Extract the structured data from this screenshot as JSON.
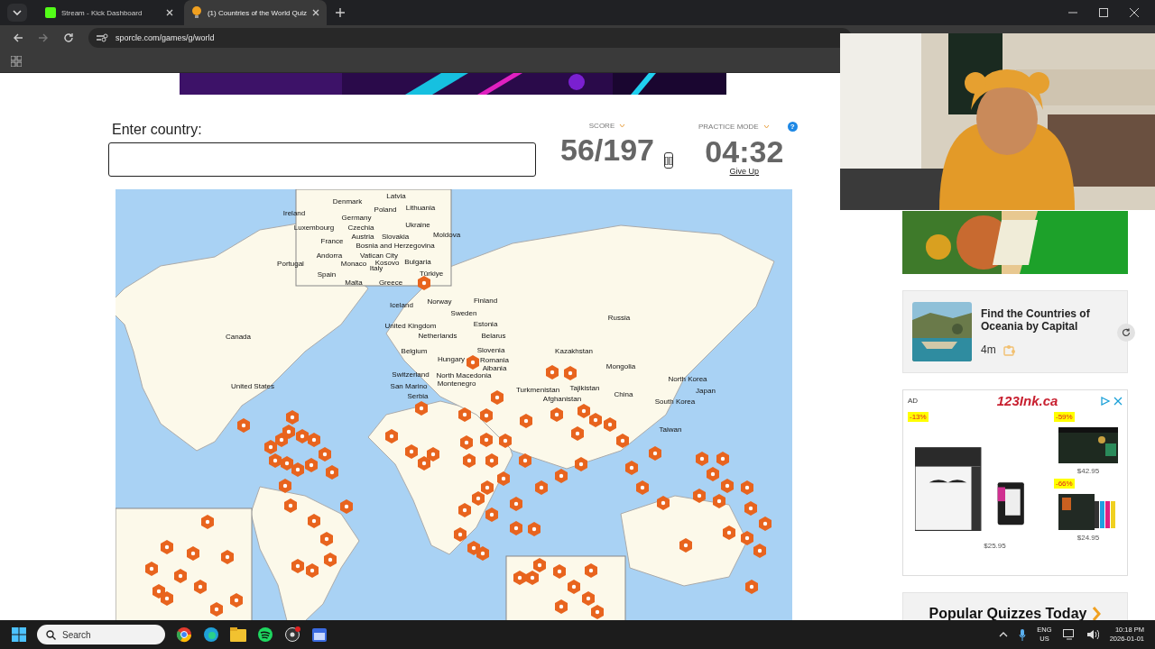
{
  "browser": {
    "tabs": [
      {
        "title": "Stream - Kick Dashboard",
        "kind": "kick",
        "selected": false
      },
      {
        "title": "(1) Countries of the World Quiz",
        "kind": "sporcle",
        "selected": true
      }
    ],
    "url": "sporcle.com/games/g/world"
  },
  "quiz": {
    "input_label": "Enter country:",
    "score_label": "SCORE",
    "score": "56/197",
    "mode_label": "PRACTICE MODE",
    "help": "?",
    "timer": "04:32",
    "give_up": "Give Up"
  },
  "map": {
    "labels": [
      {
        "name": "Denmark"
      },
      {
        "name": "Latvia"
      },
      {
        "name": "Lithuania"
      },
      {
        "name": "Poland"
      },
      {
        "name": "Ireland"
      },
      {
        "name": "Germany"
      },
      {
        "name": "Ukraine"
      },
      {
        "name": "Luxembourg"
      },
      {
        "name": "Czechia"
      },
      {
        "name": "Moldova"
      },
      {
        "name": "Austria"
      },
      {
        "name": "Slovakia"
      },
      {
        "name": "France"
      },
      {
        "name": "Bosnia and Herzegovina"
      },
      {
        "name": "Andorra"
      },
      {
        "name": "Vatican City"
      },
      {
        "name": "Portugal"
      },
      {
        "name": "Monaco"
      },
      {
        "name": "Kosovo"
      },
      {
        "name": "Bulgaria"
      },
      {
        "name": "Italy"
      },
      {
        "name": "Türkiye"
      },
      {
        "name": "Spain"
      },
      {
        "name": "Malta"
      },
      {
        "name": "Greece"
      },
      {
        "name": "Iceland"
      },
      {
        "name": "Norway"
      },
      {
        "name": "Finland"
      },
      {
        "name": "Sweden"
      },
      {
        "name": "Russia"
      },
      {
        "name": "United Kingdom"
      },
      {
        "name": "Estonia"
      },
      {
        "name": "Canada"
      },
      {
        "name": "Netherlands"
      },
      {
        "name": "Belarus"
      },
      {
        "name": "Belgium"
      },
      {
        "name": "Slovenia"
      },
      {
        "name": "Kazakhstan"
      },
      {
        "name": "Hungary"
      },
      {
        "name": "Romania"
      },
      {
        "name": "Albania"
      },
      {
        "name": "Mongolia"
      },
      {
        "name": "Switzerland"
      },
      {
        "name": "North Macedonia"
      },
      {
        "name": "North Korea"
      },
      {
        "name": "United States"
      },
      {
        "name": "San Marino"
      },
      {
        "name": "Montenegro"
      },
      {
        "name": "Turkmenistan"
      },
      {
        "name": "Tajikistan"
      },
      {
        "name": "Japan"
      },
      {
        "name": "Serbia"
      },
      {
        "name": "Afghanistan"
      },
      {
        "name": "China"
      },
      {
        "name": "South Korea"
      },
      {
        "name": "Taiwan"
      }
    ]
  },
  "sidebar": {
    "related": {
      "title": "Find the Countries of Oceania by Capital",
      "time": "4m"
    },
    "ad": {
      "badge": "AD",
      "brand": "123Ink.ca",
      "products": [
        {
          "discount": "-13%",
          "price": "$25.95"
        },
        {
          "discount": "-59%",
          "price": "$42.95"
        },
        {
          "discount": "-66%",
          "price": "$24.95"
        }
      ]
    },
    "popular": "Popular Quizzes Today"
  },
  "taskbar": {
    "search_placeholder": "Search",
    "language": "ENG",
    "region": "US",
    "time": "10:18 PM",
    "date": "2026-01-01"
  }
}
